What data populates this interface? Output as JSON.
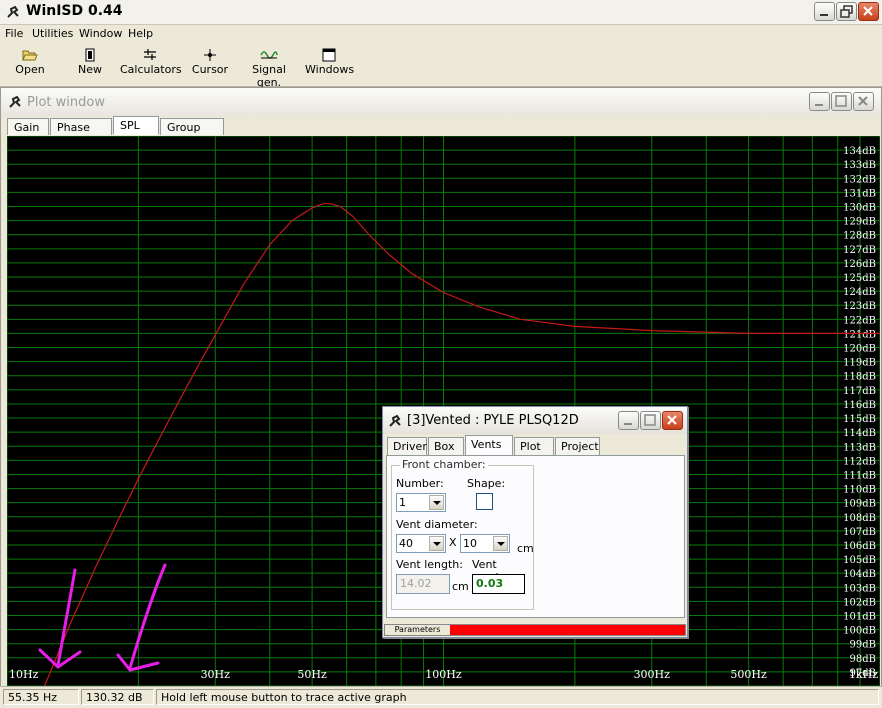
{
  "app": {
    "title": "WinISD 0.44"
  },
  "menu": [
    "File",
    "Utilities",
    "Window",
    "Help"
  ],
  "toolbar": [
    {
      "label": "Open",
      "icon": "folder-open-icon"
    },
    {
      "label": "New",
      "icon": "new-document-icon"
    },
    {
      "label": "Calculators",
      "icon": "calculator-icon"
    },
    {
      "label": "Cursor",
      "icon": "crosshair-cursor-icon"
    },
    {
      "label": "Signal gen.",
      "icon": "signal-generator-icon"
    },
    {
      "label": "Windows",
      "icon": "window-icon"
    }
  ],
  "plot_window": {
    "title": "Plot window",
    "tabs": [
      "Gain",
      "Phase plot",
      "SPL",
      "Group delay"
    ],
    "active_tab": "SPL"
  },
  "chart_data": {
    "type": "line",
    "x_scale": "log",
    "xlim": [
      10,
      1000
    ],
    "ylim": [
      96,
      135
    ],
    "x_ticks": [
      "10Hz",
      "30Hz",
      "50Hz",
      "100Hz",
      "300Hz",
      "500Hz",
      "1kHz"
    ],
    "y_ticks": [
      "97dB",
      "98dB",
      "99dB",
      "100dB",
      "101dB",
      "102dB",
      "103dB",
      "104dB",
      "105dB",
      "106dB",
      "107dB",
      "108dB",
      "109dB",
      "110dB",
      "111dB",
      "112dB",
      "113dB",
      "114dB",
      "115dB",
      "116dB",
      "117dB",
      "118dB",
      "119dB",
      "120dB",
      "121dB",
      "122dB",
      "123dB",
      "124dB",
      "125dB",
      "126dB",
      "127dB",
      "128dB",
      "129dB",
      "130dB",
      "131dB",
      "132dB",
      "133dB",
      "134dB"
    ],
    "grid": true,
    "series": [
      {
        "color": "#c41a1a",
        "x": [
          12,
          14,
          16,
          18,
          20,
          23,
          26,
          30,
          35,
          40,
          45,
          50,
          53,
          55,
          58,
          62,
          68,
          75,
          85,
          100,
          120,
          150,
          200,
          300,
          500,
          1000
        ],
        "y": [
          95.5,
          100.5,
          104.5,
          107.8,
          110.7,
          114.3,
          117.4,
          120.9,
          124.6,
          127.3,
          129.0,
          129.9,
          130.2,
          130.2,
          130.0,
          129.3,
          127.9,
          126.6,
          125.2,
          123.9,
          122.9,
          122.0,
          121.5,
          121.2,
          121.0,
          121.0
        ]
      }
    ]
  },
  "status": {
    "frequency": "55.35 Hz",
    "level": "130.32 dB",
    "hint": "Hold left mouse button to trace active graph"
  },
  "vented_dialog": {
    "title": "[3]Vented : PYLE PLSQ12D",
    "tabs": [
      "Driver",
      "Box",
      "Vents",
      "Plot",
      "Project"
    ],
    "active_tab": "Vents",
    "front_chamber_label": "Front chamber:",
    "number_label": "Number:",
    "number_value": "1",
    "shape_label": "Shape:",
    "vent_diameter_label": "Vent diameter:",
    "vent_diameter_a": "40",
    "vent_diameter_b": "10",
    "times_sign": "X",
    "unit_cm": "cm",
    "vent_length_label": "Vent length:",
    "vent_length_value": "14.02",
    "vent_mach_label": "Vent mach:",
    "vent_mach_value": "0.03",
    "bottom_tab": "Parameters"
  },
  "annotation_color": "#e81ee8"
}
